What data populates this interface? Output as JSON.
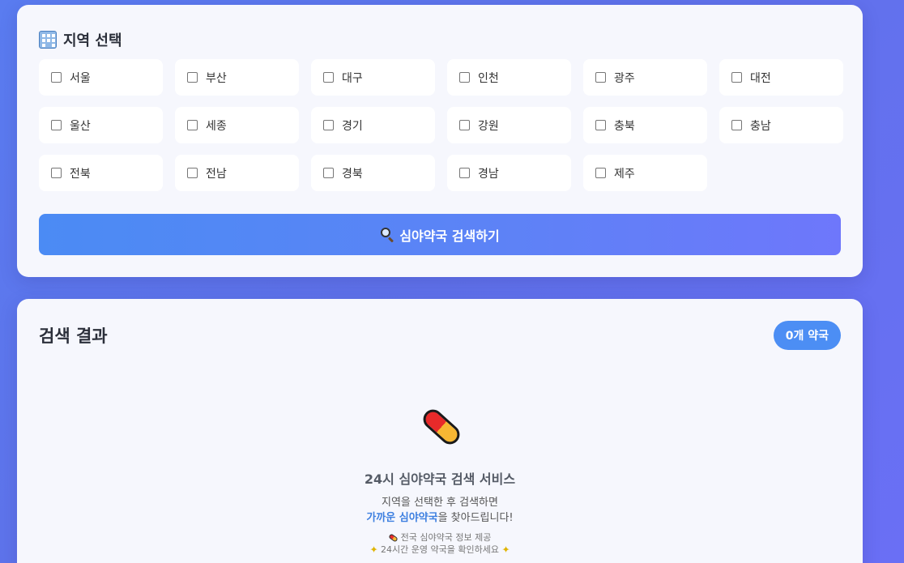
{
  "region_section": {
    "title": "지역 선택",
    "regions": [
      {
        "label": "서울",
        "checked": false
      },
      {
        "label": "부산",
        "checked": false
      },
      {
        "label": "대구",
        "checked": false
      },
      {
        "label": "인천",
        "checked": false
      },
      {
        "label": "광주",
        "checked": false
      },
      {
        "label": "대전",
        "checked": false
      },
      {
        "label": "울산",
        "checked": false
      },
      {
        "label": "세종",
        "checked": false
      },
      {
        "label": "경기",
        "checked": false
      },
      {
        "label": "강원",
        "checked": false
      },
      {
        "label": "충북",
        "checked": false
      },
      {
        "label": "충남",
        "checked": false
      },
      {
        "label": "전북",
        "checked": false
      },
      {
        "label": "전남",
        "checked": false
      },
      {
        "label": "경북",
        "checked": false
      },
      {
        "label": "경남",
        "checked": false
      },
      {
        "label": "제주",
        "checked": false
      }
    ],
    "search_button_label": "심야약국 검색하기"
  },
  "results_section": {
    "title": "검색 결과",
    "count_badge": "0개 약국",
    "empty_state": {
      "title": "24시 심야약국 검색 서비스",
      "desc_line1": "지역을 선택한 후 검색하면",
      "desc_line2_highlight": "가까운 심야약국",
      "desc_line2_rest": "을 찾아드립니다!",
      "note1": "전국 심야약국 정보 제공",
      "note2": "24시간 운영 약국을 확인하세요"
    }
  },
  "colors": {
    "background": "#5f72ea",
    "accent": "#4c8ef4",
    "button_gradient_end": "#6e77fb",
    "highlight": "#3d7fe0"
  },
  "icons": {
    "section_icon": "building-icon",
    "search": "search-icon",
    "empty_state": "pill-icon",
    "note_bullets": [
      "pill-icon",
      "sparkle-icon"
    ]
  }
}
